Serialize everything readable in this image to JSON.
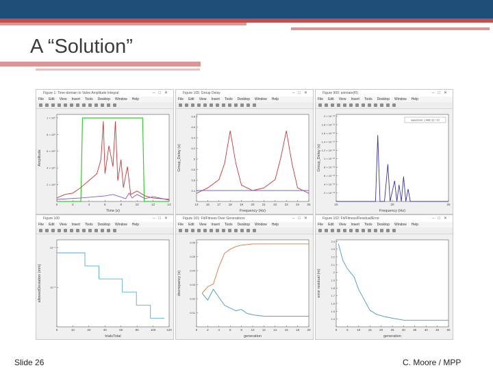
{
  "slide": {
    "title": "A “Solution”",
    "footer_left": "Slide 26",
    "footer_right": "C. Moore / MPP"
  },
  "figure_menu": [
    "File",
    "Edit",
    "View",
    "Insert",
    "Tools",
    "Desktop",
    "Window",
    "Help"
  ],
  "colors": {
    "header": "#1f4e79",
    "accent_red": "#c0504d",
    "accent_pink": "#d99694"
  },
  "panels": [
    {
      "window_title": "Figure 1: Time-domain to Valve Amplitude Integral",
      "chart_data": {
        "type": "line",
        "xlabel": "Time (s)",
        "ylabel": "Amplitude",
        "x_ticks": [
          "0",
          "2",
          "4",
          "6",
          "8",
          "10",
          "12",
          "14"
        ],
        "y_ticks": [
          "2 × 10⁵",
          "4 × 10⁵",
          "6 × 10⁵",
          "8 × 10⁵",
          "1 × 10⁶"
        ],
        "xlim": [
          0,
          14
        ],
        "ylim": [
          0,
          1.25
        ],
        "series": [
          {
            "color": "#33cc33",
            "points": [
              [
                0,
                0
              ],
              [
                3,
                0
              ],
              [
                3.2,
                1.2
              ],
              [
                10.7,
                1.2
              ],
              [
                10.9,
                0
              ],
              [
                14,
                0
              ]
            ]
          },
          {
            "color": "#cc3333",
            "points": [
              [
                0,
                0.05
              ],
              [
                1,
                0.1
              ],
              [
                2,
                0.12
              ],
              [
                3,
                0.2
              ],
              [
                4,
                0.3
              ],
              [
                5,
                0.4
              ],
              [
                5.5,
                0.6
              ],
              [
                5.8,
                1.15
              ],
              [
                6,
                0.4
              ],
              [
                6.5,
                0.8
              ],
              [
                7,
                0.5
              ],
              [
                7.3,
                1.15
              ],
              [
                7.6,
                0.3
              ],
              [
                8,
                0.6
              ],
              [
                8.3,
                0.2
              ],
              [
                8.8,
                0.5
              ],
              [
                9.2,
                0.1
              ],
              [
                10,
                0.15
              ],
              [
                11,
                0.08
              ],
              [
                12,
                0.05
              ],
              [
                14,
                0.03
              ]
            ]
          },
          {
            "color": "#8855cc",
            "points": [
              [
                0,
                0.03
              ],
              [
                3,
                0.05
              ],
              [
                6,
                0.08
              ],
              [
                7,
                0.1
              ],
              [
                8.6,
                0.04
              ],
              [
                9,
                0.12
              ],
              [
                9.4,
                0.05
              ],
              [
                10,
                0.1
              ],
              [
                11,
                0.04
              ],
              [
                12,
                0.07
              ],
              [
                14,
                0.02
              ]
            ]
          }
        ]
      }
    },
    {
      "window_title": "Figure 105: Group Delay",
      "chart_data": {
        "type": "line",
        "xlabel": "Frequency (Hz)",
        "ylabel": "Group_Delay (s)",
        "x_ticks": [
          "13",
          "16",
          "17",
          "18",
          "19",
          "20",
          "21",
          "22",
          "23",
          "24",
          "25"
        ],
        "y_ticks": [
          "5.4",
          "5.6",
          "5.8",
          "6",
          "6.2",
          "6.4",
          "6.6",
          "6.8"
        ],
        "xlim": [
          15,
          25
        ],
        "ylim": [
          5.3,
          6.9
        ],
        "series": [
          {
            "color": "#cc3333",
            "points": [
              [
                15,
                5.45
              ],
              [
                16,
                5.55
              ],
              [
                17,
                5.7
              ],
              [
                17.5,
                6.0
              ],
              [
                18,
                6.6
              ],
              [
                18.5,
                6.0
              ],
              [
                19,
                5.6
              ],
              [
                20,
                5.5
              ],
              [
                21,
                5.55
              ],
              [
                22,
                5.7
              ],
              [
                22.5,
                6.1
              ],
              [
                23,
                6.6
              ],
              [
                23.5,
                6.0
              ],
              [
                24,
                5.55
              ],
              [
                25,
                5.45
              ]
            ]
          },
          {
            "color": "#5555cc",
            "points": [
              [
                15,
                5.5
              ],
              [
                25,
                5.5
              ]
            ]
          }
        ]
      }
    },
    {
      "window_title": "Figure 900: animate(f0)",
      "chart_data": {
        "type": "line",
        "xlabel": "Frequency (Hz)",
        "ylabel": "Group_Delay (s)",
        "x_ticks": [
          "15",
          "20",
          "25"
        ],
        "y_ticks": [
          "2 × 10⁻¹³",
          "4 × 10⁻¹³",
          "6 × 10⁻¹³",
          "8 × 10⁻¹³",
          "1 × 10⁻¹²",
          "1.2 × 10⁻¹²",
          "1.4 × 10⁻¹²",
          "1.6 × 10⁻¹²",
          "1.8 × 10⁻¹²",
          "2 × 10⁻¹²"
        ],
        "xlim": [
          15,
          25
        ],
        "ylim": [
          0,
          2.1
        ],
        "legend": "waveSum: 1.40E-12 / 10",
        "series": [
          {
            "color": "#3333aa",
            "points": [
              [
                15,
                0
              ],
              [
                18.5,
                0
              ],
              [
                18.7,
                1.6
              ],
              [
                18.9,
                0
              ],
              [
                19.3,
                0
              ],
              [
                19.6,
                0.9
              ],
              [
                19.8,
                0
              ],
              [
                20.2,
                0.5
              ],
              [
                20.4,
                0
              ],
              [
                20.6,
                0.4
              ],
              [
                20.8,
                0
              ],
              [
                21,
                0.6
              ],
              [
                21.2,
                0
              ],
              [
                21.4,
                0.3
              ],
              [
                21.6,
                0
              ],
              [
                25,
                0
              ]
            ]
          }
        ]
      }
    },
    {
      "window_title": "Figure 100",
      "chart_data": {
        "type": "line",
        "xlabel": "trialsTotal",
        "ylabel": "allowedDeviation (mm)",
        "x_ticks": [
          "0",
          "10",
          "20",
          "40",
          "60",
          "80",
          "100",
          "120"
        ],
        "y_ticks": [
          "10⁻³",
          "10⁻⁴"
        ],
        "xlim": [
          0,
          120
        ],
        "ylim": [
          0,
          10
        ],
        "series": [
          {
            "color": "#55aadd",
            "points": [
              [
                0,
                8.5
              ],
              [
                30,
                8.5
              ],
              [
                30,
                7
              ],
              [
                45,
                7
              ],
              [
                45,
                5.5
              ],
              [
                70,
                5.5
              ],
              [
                70,
                4
              ],
              [
                85,
                4
              ],
              [
                85,
                2.5
              ],
              [
                100,
                2.5
              ],
              [
                100,
                1
              ],
              [
                115,
                1
              ]
            ]
          }
        ]
      }
    },
    {
      "window_title": "Figure 101: Fit/Fitness Over Generations",
      "chart_data": {
        "type": "line",
        "xlabel": "generation",
        "ylabel": "discrepancy (s)",
        "x_ticks": [
          "0",
          "2",
          "4",
          "6",
          "8",
          "10",
          "12",
          "14",
          "16",
          "18",
          "20"
        ],
        "y_ticks": [
          "0.01",
          "0.02",
          "0.03",
          "0.04",
          "0.05",
          "0.06"
        ],
        "xlim": [
          0,
          20
        ],
        "ylim": [
          0,
          0.065
        ],
        "series": [
          {
            "color": "#dd7733",
            "points": [
              [
                1,
                0.025
              ],
              [
                2,
                0.03
              ],
              [
                3,
                0.032
              ],
              [
                4,
                0.045
              ],
              [
                5,
                0.055
              ],
              [
                6,
                0.058
              ],
              [
                7,
                0.06
              ],
              [
                8,
                0.061
              ],
              [
                10,
                0.062
              ],
              [
                12,
                0.062
              ],
              [
                14,
                0.062
              ],
              [
                16,
                0.062
              ],
              [
                18,
                0.062
              ],
              [
                20,
                0.062
              ]
            ]
          },
          {
            "color": "#4499bb",
            "points": [
              [
                1,
                0.025
              ],
              [
                2,
                0.02
              ],
              [
                3,
                0.028
              ],
              [
                4,
                0.022
              ],
              [
                5,
                0.016
              ],
              [
                6,
                0.014
              ],
              [
                7,
                0.012
              ],
              [
                8,
                0.013
              ],
              [
                9,
                0.01
              ],
              [
                10,
                0.009
              ],
              [
                12,
                0.008
              ],
              [
                14,
                0.008
              ],
              [
                16,
                0.008
              ],
              [
                18,
                0.008
              ],
              [
                20,
                0.008
              ]
            ]
          }
        ]
      }
    },
    {
      "window_title": "Figure 102: Fit/Fitness/Residual/Error",
      "chart_data": {
        "type": "line",
        "xlabel": "generation",
        "ylabel": "error residual (m)",
        "x_ticks": [
          "0",
          "5",
          "10",
          "15",
          "20",
          "25",
          "30",
          "35",
          "40",
          "45",
          "50"
        ],
        "y_ticks": [
          "1.4",
          "1.5",
          "1.6",
          "1.7",
          "1.8",
          "1.9",
          "2",
          "2.1",
          "2.2",
          "2.3",
          "2.4"
        ],
        "xlim": [
          0,
          50
        ],
        "ylim": [
          1.4,
          2.45
        ],
        "series": [
          {
            "color": "#4499bb",
            "points": [
              [
                1,
                2.4
              ],
              [
                3,
                2.2
              ],
              [
                5,
                2.1
              ],
              [
                8,
                2.0
              ],
              [
                10,
                1.85
              ],
              [
                12,
                1.75
              ],
              [
                15,
                1.6
              ],
              [
                18,
                1.55
              ],
              [
                22,
                1.52
              ],
              [
                26,
                1.5
              ],
              [
                30,
                1.48
              ],
              [
                40,
                1.48
              ],
              [
                50,
                1.48
              ]
            ]
          }
        ]
      }
    }
  ]
}
